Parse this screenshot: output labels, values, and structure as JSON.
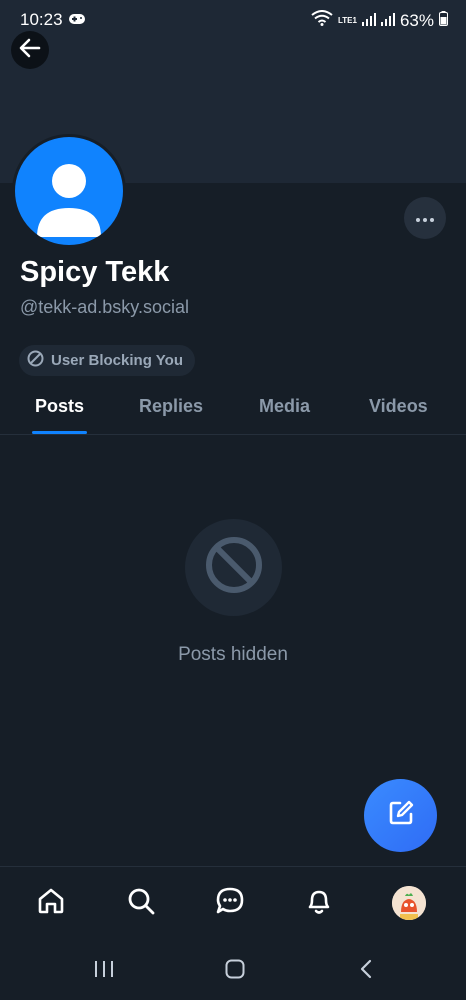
{
  "status_bar": {
    "time": "10:23",
    "battery": "63%",
    "network": "LTE1"
  },
  "profile": {
    "display_name": "Spicy Tekk",
    "handle": "@tekk-ad.bsky.social",
    "blocking_badge": "User Blocking You"
  },
  "tabs": [
    {
      "label": "Posts",
      "active": true
    },
    {
      "label": "Replies",
      "active": false
    },
    {
      "label": "Media",
      "active": false
    },
    {
      "label": "Videos",
      "active": false
    }
  ],
  "empty_state": {
    "message": "Posts hidden",
    "icon": "blocked-icon"
  },
  "bottom_nav": {
    "items": [
      "home-icon",
      "search-icon",
      "chat-icon",
      "bell-icon",
      "profile-avatar"
    ]
  },
  "colors": {
    "background": "#161e27",
    "banner": "#1e2835",
    "accent": "#1083fe",
    "muted_text": "#8b99a9"
  }
}
